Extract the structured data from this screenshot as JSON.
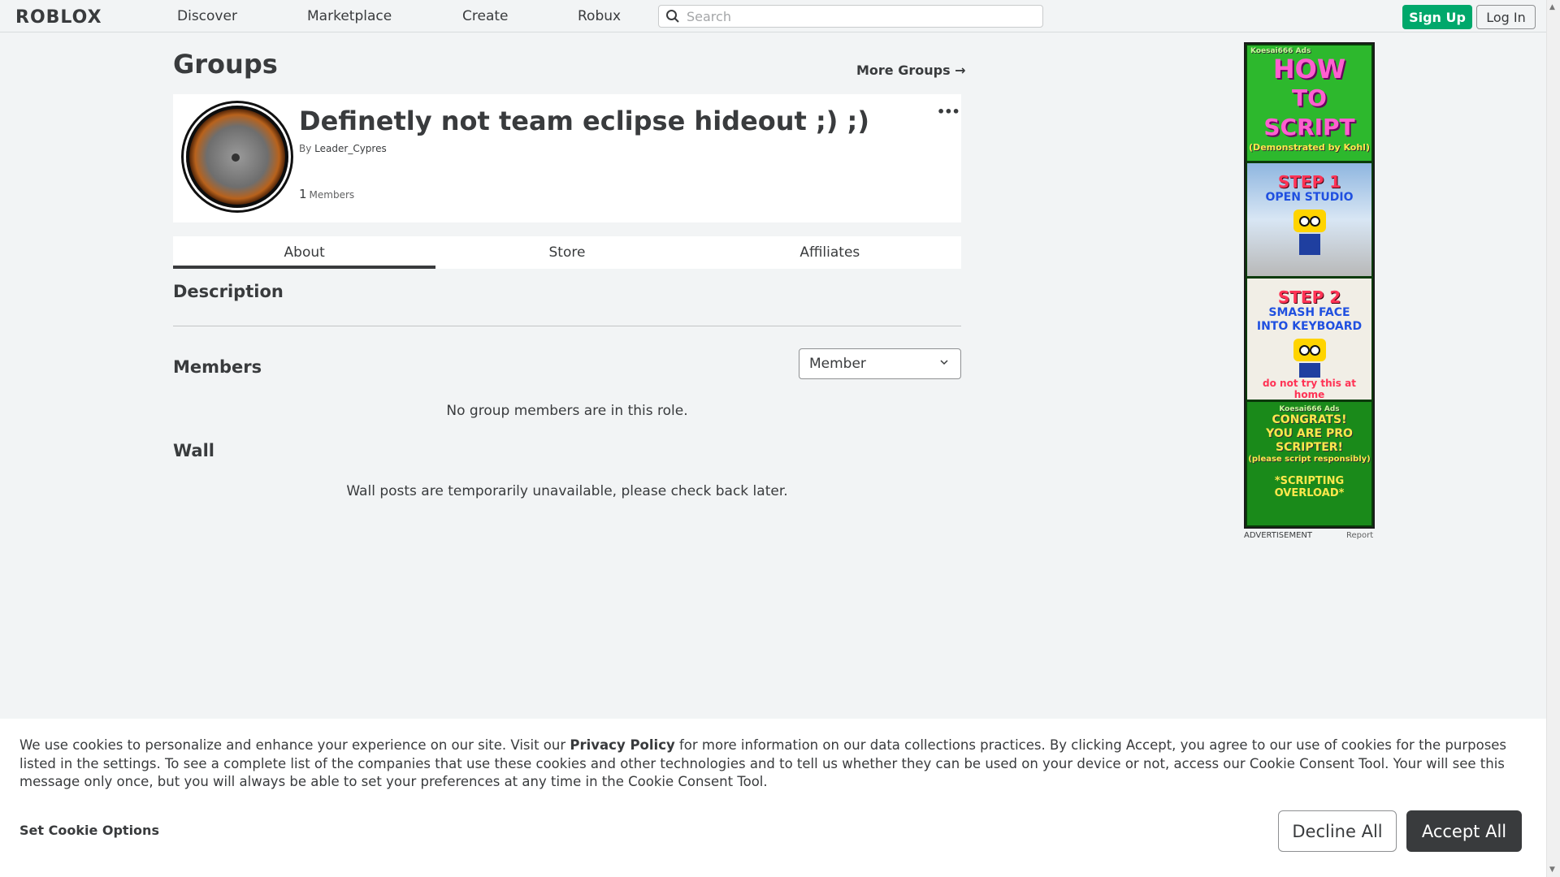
{
  "header": {
    "logo": "ROBLOX",
    "nav": [
      "Discover",
      "Marketplace",
      "Create",
      "Robux"
    ],
    "search_placeholder": "Search",
    "signup_label": "Sign Up",
    "login_label": "Log In"
  },
  "page": {
    "title": "Groups",
    "more_groups": "More Groups →"
  },
  "group": {
    "name": "Definetly not team eclipse hideout ;) ;)",
    "by_prefix": "By",
    "owner": "Leader_Cypres",
    "member_count": "1",
    "member_label": "Members",
    "more_icon": "•••"
  },
  "tabs": [
    {
      "label": "About",
      "active": true
    },
    {
      "label": "Store",
      "active": false
    },
    {
      "label": "Affiliates",
      "active": false
    }
  ],
  "sections": {
    "description": "Description",
    "members": "Members",
    "role_selected": "Member",
    "no_members": "No group members are in this role.",
    "wall": "Wall",
    "wall_unavailable": "Wall posts are temporarily unavailable, please check back later."
  },
  "ad": {
    "panel1_brand": "Koesai666 Ads",
    "panel1_title_a": "HOW",
    "panel1_title_b": "TO SCRIPT",
    "panel1_sub": "(Demonstrated by Kohl)",
    "panel2_step": "STEP 1",
    "panel2_text": "OPEN STUDIO",
    "panel3_step": "STEP 2",
    "panel3_text_a": "SMASH FACE",
    "panel3_text_b": "INTO KEYBOARD",
    "panel3_warn": "do not try this at home",
    "panel4_brand": "Koesai666 Ads",
    "panel4_congrats_a": "CONGRATS!",
    "panel4_congrats_b": "YOU ARE PRO SCRIPTER!",
    "panel4_sub": "(please script responsibly)",
    "panel4_overload": "*SCRIPTING OVERLOAD*",
    "label": "ADVERTISEMENT",
    "report": "Report"
  },
  "cookie": {
    "text_a": "We use cookies to personalize and enhance your experience on our site. Visit our ",
    "privacy_link": "Privacy Policy",
    "text_b": " for more information on our data collections practices. By clicking Accept, you agree to our use of cookies for the purposes listed in the settings. To see a complete list of the companies that use these cookies and other technologies and to tell us whether they can be used on your device or not, access our Cookie Consent Tool. Your will see this message only once, but you will always be able to set your preferences at any time in the Cookie Consent Tool.",
    "options": "Set Cookie Options",
    "decline": "Decline All",
    "accept": "Accept All"
  }
}
